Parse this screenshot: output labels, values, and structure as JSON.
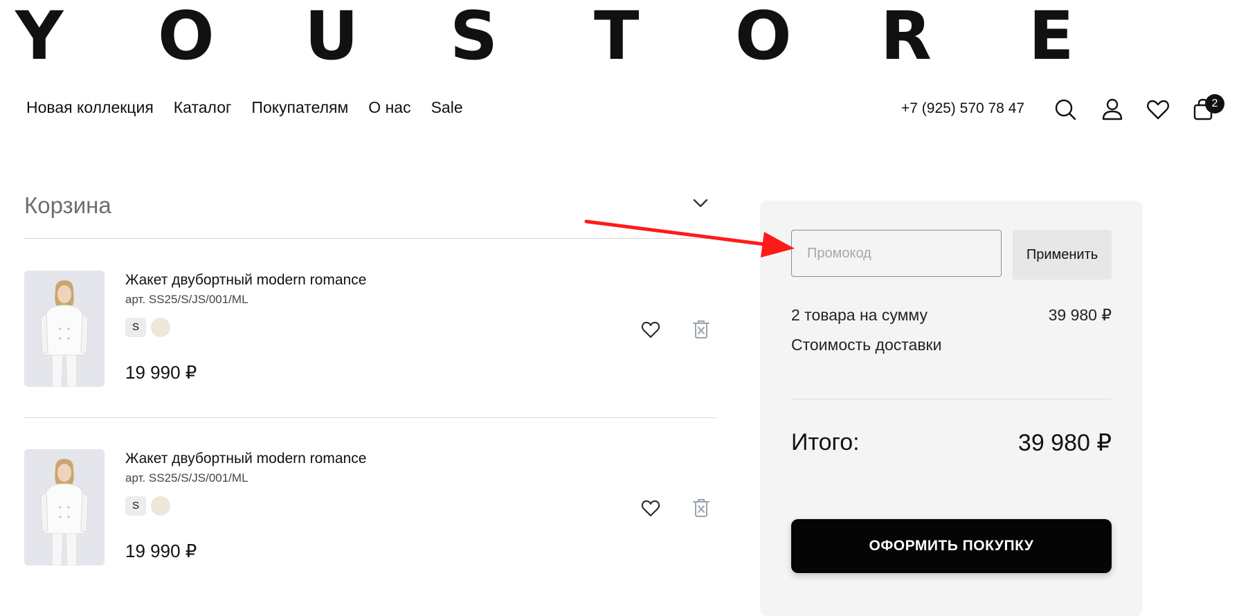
{
  "brand": {
    "letters": [
      "Y",
      "O",
      "U",
      "S",
      "T",
      "O",
      "R",
      "E"
    ]
  },
  "nav": {
    "items": [
      "Новая коллекция",
      "Каталог",
      "Покупателям",
      "О нас",
      "Sale"
    ]
  },
  "header": {
    "phone": "+7 (925) 570 78 47",
    "icons": [
      "search-icon",
      "user-icon",
      "heart-icon",
      "bag-icon"
    ],
    "cart_count": "2"
  },
  "cart": {
    "title": "Корзина",
    "items": [
      {
        "name": "Жакет двубортный modern romance",
        "sku": "арт. SS25/S/JS/001/ML",
        "size": "S",
        "color": "#eee6d8",
        "price": "19 990 ₽"
      },
      {
        "name": "Жакет двубортный modern romance",
        "sku": "арт. SS25/S/JS/001/ML",
        "size": "S",
        "color": "#eee6d8",
        "price": "19 990 ₽"
      }
    ]
  },
  "summary": {
    "promo_placeholder": "Промокод",
    "apply_label": "Применить",
    "items_label": "2 товара на сумму",
    "items_value": "39 980 ₽",
    "delivery_label": "Стоимость доставки",
    "total_label": "Итого:",
    "total_value": "39 980 ₽",
    "checkout_label": "ОФОРМИТЬ ПОКУПКУ"
  },
  "colors": {
    "accent": "#050505",
    "panel": "#f4f4f4",
    "annotation_arrow": "#ff1a1a"
  }
}
